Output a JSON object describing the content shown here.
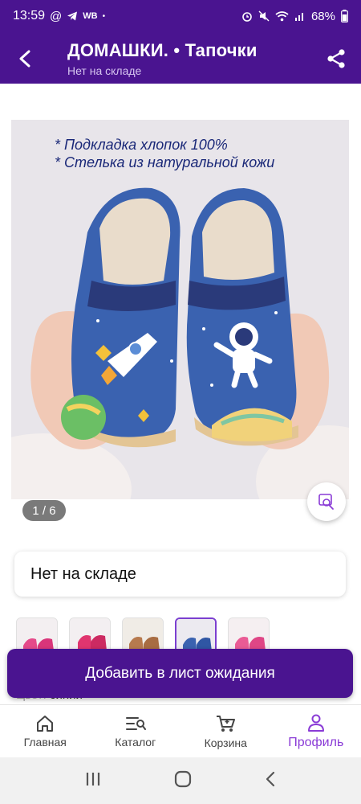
{
  "status_bar": {
    "time": "13:59",
    "carrier_small": "WB",
    "dot": "•",
    "battery": "68%"
  },
  "header": {
    "title": "ДОМАШКИ. • Тапочки",
    "subtitle": "Нет на складе"
  },
  "image": {
    "caption_line1": "* Подкладка хлопок 100%",
    "caption_line2": "* Стелька из натуральной кожи",
    "counter": "1 / 6"
  },
  "stock": {
    "label": "Нет на складе"
  },
  "thumbnails": {
    "count": 5,
    "selected_index": 3
  },
  "color": {
    "key": "Цвет:",
    "value": "синий"
  },
  "cta": {
    "label": "Добавить в лист ожидания"
  },
  "bottom_nav": {
    "items": [
      {
        "label": "Главная",
        "icon": "home-icon"
      },
      {
        "label": "Каталог",
        "icon": "catalog-icon"
      },
      {
        "label": "Корзина",
        "icon": "cart-icon"
      },
      {
        "label": "Профиль",
        "icon": "profile-icon"
      }
    ],
    "active": "Профиль"
  },
  "colors": {
    "brand": "#4a1490",
    "active_nav": "#8a3bd6"
  }
}
